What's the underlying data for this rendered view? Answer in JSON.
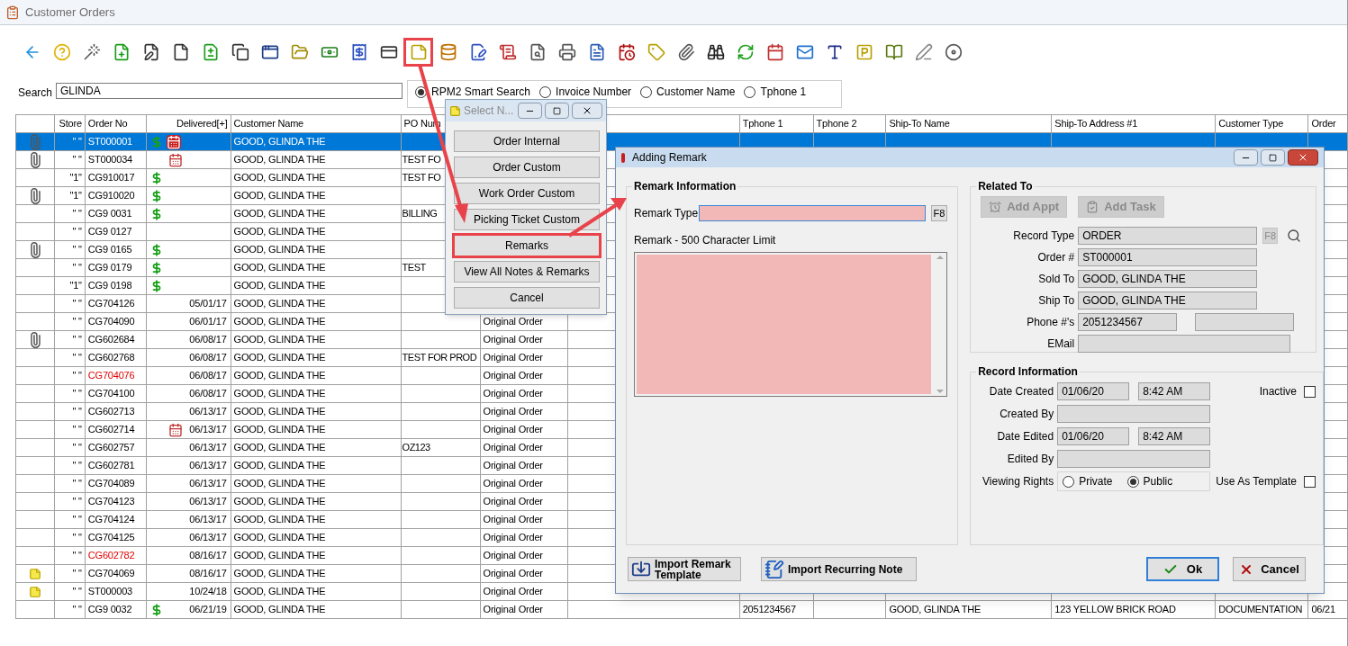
{
  "window": {
    "title": "Customer Orders"
  },
  "toolbar": [
    {
      "kind": "back",
      "highlighted": false
    },
    {
      "kind": "help",
      "highlighted": false
    },
    {
      "kind": "wand",
      "highlighted": false
    },
    {
      "kind": "add",
      "highlighted": false
    },
    {
      "kind": "edit",
      "highlighted": false
    },
    {
      "kind": "file",
      "highlighted": false
    },
    {
      "kind": "diff",
      "highlighted": false
    },
    {
      "kind": "copy",
      "highlighted": false
    },
    {
      "kind": "windows",
      "highlighted": false
    },
    {
      "kind": "folder",
      "highlighted": false
    },
    {
      "kind": "money",
      "highlighted": false
    },
    {
      "kind": "receipt",
      "highlighted": false
    },
    {
      "kind": "credit",
      "highlighted": false
    },
    {
      "kind": "note",
      "highlighted": true
    },
    {
      "kind": "database",
      "highlighted": false
    },
    {
      "kind": "sign",
      "highlighted": false
    },
    {
      "kind": "check",
      "highlighted": false
    },
    {
      "kind": "preview",
      "highlighted": false
    },
    {
      "kind": "print",
      "highlighted": false
    },
    {
      "kind": "document",
      "highlighted": false
    },
    {
      "kind": "due",
      "highlighted": false
    },
    {
      "kind": "ticket",
      "highlighted": false
    },
    {
      "kind": "attach",
      "highlighted": false
    },
    {
      "kind": "find",
      "highlighted": false
    },
    {
      "kind": "refresh",
      "highlighted": false
    },
    {
      "kind": "calendar",
      "highlighted": false
    },
    {
      "kind": "mail",
      "highlighted": false
    },
    {
      "kind": "type",
      "highlighted": false
    },
    {
      "kind": "parking",
      "highlighted": false
    },
    {
      "kind": "book",
      "highlighted": false
    },
    {
      "kind": "pen",
      "highlighted": false
    },
    {
      "kind": "disc",
      "highlighted": false
    }
  ],
  "search": {
    "label": "Search",
    "value": "GLINDA",
    "modes": [
      {
        "label": "RPM2 Smart Search",
        "selected": true
      },
      {
        "label": "Invoice Number",
        "selected": false
      },
      {
        "label": "Customer Name",
        "selected": false
      },
      {
        "label": "Tphone 1",
        "selected": false
      }
    ]
  },
  "table": {
    "columns": {
      "store": "Store",
      "order_no": "Order No",
      "delivered": "Delivered[+]",
      "customer_name": "Customer Name",
      "po_number": "PO Num",
      "tphone_1": "Tphone 1",
      "tphone_2": "Tphone 2",
      "ship_to_name": "Ship-To Name",
      "ship_to_address": "Ship-To Address #1",
      "customer_type": "Customer Type",
      "order": "Order"
    },
    "rows": [
      {
        "attachment": true,
        "note": false,
        "paid": true,
        "alert": true,
        "scheduled": false,
        "store": "\" \"",
        "order_no": "ST000001",
        "customer_name": "GOOD, GLINDA THE",
        "flagged": false,
        "selected": true
      },
      {
        "attachment": true,
        "note": false,
        "paid": false,
        "alert": false,
        "scheduled": true,
        "store": "\" \"",
        "order_no": "ST000034",
        "customer_name": "GOOD, GLINDA THE",
        "po_number": "TEST FO",
        "flagged": false,
        "selected": false
      },
      {
        "attachment": false,
        "note": false,
        "paid": true,
        "alert": false,
        "scheduled": false,
        "store": "\"1\"",
        "order_no": "CG910017",
        "customer_name": "GOOD, GLINDA THE",
        "po_number": "TEST FO",
        "flagged": false,
        "selected": false
      },
      {
        "attachment": true,
        "note": false,
        "paid": true,
        "alert": false,
        "scheduled": false,
        "store": "\"1\"",
        "order_no": "CG910020",
        "customer_name": "GOOD, GLINDA THE",
        "flagged": false,
        "selected": false
      },
      {
        "attachment": false,
        "note": false,
        "paid": true,
        "alert": false,
        "scheduled": false,
        "store": "\" \"",
        "order_no": "CG9 0031",
        "customer_name": "GOOD, GLINDA THE",
        "po_number": "BILLING",
        "flagged": false,
        "selected": false
      },
      {
        "attachment": false,
        "note": false,
        "paid": false,
        "alert": false,
        "scheduled": false,
        "store": "\" \"",
        "order_no": "CG9 0127",
        "customer_name": "GOOD, GLINDA THE",
        "flagged": false,
        "selected": false
      },
      {
        "attachment": true,
        "note": false,
        "paid": true,
        "alert": false,
        "scheduled": false,
        "store": "\" \"",
        "order_no": "CG9 0165",
        "customer_name": "GOOD, GLINDA THE",
        "flagged": false,
        "selected": false
      },
      {
        "attachment": false,
        "note": false,
        "paid": true,
        "alert": false,
        "scheduled": false,
        "store": "\" \"",
        "order_no": "CG9 0179",
        "customer_name": "GOOD, GLINDA THE",
        "po_number": "TEST",
        "flagged": false,
        "selected": false
      },
      {
        "attachment": false,
        "note": false,
        "paid": true,
        "alert": false,
        "scheduled": false,
        "store": "\"1\"",
        "order_no": "CG9 0198",
        "customer_name": "GOOD, GLINDA THE",
        "flagged": false,
        "selected": false
      },
      {
        "attachment": false,
        "note": false,
        "paid": false,
        "alert": false,
        "scheduled": false,
        "store": "\" \"",
        "order_no": "CG704126",
        "delivered": "05/01/17",
        "customer_name": "GOOD, GLINDA THE",
        "flagged": false,
        "selected": false
      },
      {
        "attachment": false,
        "note": false,
        "paid": false,
        "alert": false,
        "scheduled": false,
        "store": "\" \"",
        "order_no": "CG704090",
        "delivered": "06/01/17",
        "customer_name": "GOOD, GLINDA THE",
        "column_7": "Original Order",
        "flagged": false,
        "selected": false
      },
      {
        "attachment": true,
        "note": false,
        "paid": false,
        "alert": false,
        "scheduled": false,
        "store": "\" \"",
        "order_no": "CG602684",
        "delivered": "06/08/17",
        "customer_name": "GOOD, GLINDA THE",
        "column_7": "Original Order",
        "flagged": false,
        "selected": false
      },
      {
        "attachment": false,
        "note": false,
        "paid": false,
        "alert": false,
        "scheduled": false,
        "store": "\" \"",
        "order_no": "CG602768",
        "delivered": "06/08/17",
        "customer_name": "GOOD, GLINDA THE",
        "po_number": "TEST FOR PROD",
        "column_7": "Original Order",
        "flagged": false,
        "selected": false
      },
      {
        "attachment": false,
        "note": false,
        "paid": false,
        "alert": false,
        "scheduled": false,
        "store": "\" \"",
        "order_no": "CG704076",
        "delivered": "06/08/17",
        "customer_name": "GOOD, GLINDA THE",
        "column_7": "Original Order",
        "flagged": true,
        "selected": false
      },
      {
        "attachment": false,
        "note": false,
        "paid": false,
        "alert": false,
        "scheduled": false,
        "store": "\" \"",
        "order_no": "CG704100",
        "delivered": "06/08/17",
        "customer_name": "GOOD, GLINDA THE",
        "column_7": "Original Order",
        "flagged": false,
        "selected": false
      },
      {
        "attachment": false,
        "note": false,
        "paid": false,
        "alert": false,
        "scheduled": false,
        "store": "\" \"",
        "order_no": "CG602713",
        "delivered": "06/13/17",
        "customer_name": "GOOD, GLINDA THE",
        "column_7": "Original Order",
        "flagged": false,
        "selected": false
      },
      {
        "attachment": false,
        "note": false,
        "paid": false,
        "alert": false,
        "scheduled": true,
        "store": "\" \"",
        "order_no": "CG602714",
        "delivered": "06/13/17",
        "customer_name": "GOOD, GLINDA THE",
        "column_7": "Original Order",
        "flagged": false,
        "selected": false
      },
      {
        "attachment": false,
        "note": false,
        "paid": false,
        "alert": false,
        "scheduled": false,
        "store": "\" \"",
        "order_no": "CG602757",
        "delivered": "06/13/17",
        "customer_name": "GOOD, GLINDA THE",
        "po_number": "OZ123",
        "column_7": "Original Order",
        "flagged": false,
        "selected": false
      },
      {
        "attachment": false,
        "note": false,
        "paid": false,
        "alert": false,
        "scheduled": false,
        "store": "\" \"",
        "order_no": "CG602781",
        "delivered": "06/13/17",
        "customer_name": "GOOD, GLINDA THE",
        "column_7": "Original Order",
        "flagged": false,
        "selected": false
      },
      {
        "attachment": false,
        "note": false,
        "paid": false,
        "alert": false,
        "scheduled": false,
        "store": "\" \"",
        "order_no": "CG704089",
        "delivered": "06/13/17",
        "customer_name": "GOOD, GLINDA THE",
        "column_7": "Original Order",
        "flagged": false,
        "selected": false
      },
      {
        "attachment": false,
        "note": false,
        "paid": false,
        "alert": false,
        "scheduled": false,
        "store": "\" \"",
        "order_no": "CG704123",
        "delivered": "06/13/17",
        "customer_name": "GOOD, GLINDA THE",
        "column_7": "Original Order",
        "flagged": false,
        "selected": false
      },
      {
        "attachment": false,
        "note": false,
        "paid": false,
        "alert": false,
        "scheduled": false,
        "store": "\" \"",
        "order_no": "CG704124",
        "delivered": "06/13/17",
        "customer_name": "GOOD, GLINDA THE",
        "column_7": "Original Order",
        "flagged": false,
        "selected": false
      },
      {
        "attachment": false,
        "note": false,
        "paid": false,
        "alert": false,
        "scheduled": false,
        "store": "\" \"",
        "order_no": "CG704125",
        "delivered": "06/13/17",
        "customer_name": "GOOD, GLINDA THE",
        "column_7": "Original Order",
        "flagged": false,
        "selected": false
      },
      {
        "attachment": false,
        "note": false,
        "paid": false,
        "alert": false,
        "scheduled": false,
        "store": "\" \"",
        "order_no": "CG602782",
        "delivered": "08/16/17",
        "customer_name": "GOOD, GLINDA THE",
        "column_7": "Original Order",
        "flagged": true,
        "selected": false
      },
      {
        "attachment": false,
        "note": true,
        "paid": false,
        "alert": false,
        "scheduled": false,
        "store": "\" \"",
        "order_no": "CG704069",
        "delivered": "08/16/17",
        "customer_name": "GOOD, GLINDA THE",
        "column_7": "Original Order",
        "flagged": false,
        "selected": false
      },
      {
        "attachment": false,
        "note": true,
        "paid": false,
        "alert": false,
        "scheduled": false,
        "store": "\" \"",
        "order_no": "ST000003",
        "delivered": "10/24/18",
        "customer_name": "GOOD, GLINDA THE",
        "column_7": "Original Order",
        "flagged": false,
        "selected": false
      },
      {
        "attachment": false,
        "note": false,
        "paid": true,
        "alert": false,
        "scheduled": false,
        "store": "\" \"",
        "order_no": "CG9 0032",
        "delivered": "06/21/19",
        "customer_name": "GOOD, GLINDA THE",
        "column_7": "Original Order",
        "tphone_1": "2051234567",
        "ship_to_name": "GOOD, GLINDA THE",
        "ship_to_address": "123 YELLOW BRICK ROAD",
        "customer_type": "DOCUMENTATION",
        "order": "06/21",
        "flagged": false,
        "selected": false
      }
    ]
  },
  "menu": {
    "title": "Select N...",
    "items": [
      {
        "label": "Order Internal",
        "highlighted": false
      },
      {
        "label": "Order Custom",
        "highlighted": false
      },
      {
        "label": "Work Order Custom",
        "highlighted": false
      },
      {
        "label": "Picking Ticket Custom",
        "highlighted": false
      },
      {
        "label": "Remarks",
        "highlighted": true
      },
      {
        "label": "View All Notes & Remarks",
        "highlighted": false
      },
      {
        "label": "Cancel",
        "highlighted": false
      }
    ]
  },
  "dialog": {
    "title": "Adding Remark",
    "remark_information": {
      "title": "Remark Information",
      "type_label": "Remark Type",
      "type_key": "F8",
      "text_label": "Remark - 500 Character Limit",
      "required": true
    },
    "related_to": {
      "title": "Related To",
      "buttons": [
        {
          "label": "Add Appt",
          "kind": "appointment",
          "disabled": true
        },
        {
          "label": "Add Task",
          "kind": "task",
          "disabled": true
        }
      ],
      "fields": [
        {
          "kind": "lookup",
          "label": "Record Type",
          "values": [
            "ORDER"
          ],
          "key": "F8"
        },
        {
          "kind": "text",
          "label": "Order #",
          "values": [
            "ST000001"
          ]
        },
        {
          "kind": "text",
          "label": "Sold To",
          "values": [
            "GOOD, GLINDA THE"
          ]
        },
        {
          "kind": "text",
          "label": "Ship To",
          "values": [
            "GOOD, GLINDA THE"
          ]
        },
        {
          "kind": "pair",
          "label": "Phone #'s",
          "values": [
            "2051234567"
          ]
        },
        {
          "kind": "long",
          "label": "EMail"
        }
      ]
    },
    "record_information": {
      "title": "Record Information",
      "rows": [
        {
          "kind": "datetime",
          "label": "Date Created",
          "values": [
            "01/06/20",
            "8:42 AM"
          ],
          "checkbox": {
            "label": "Inactive",
            "checked": false
          }
        },
        {
          "kind": "text",
          "label": "Created By"
        },
        {
          "kind": "datetime",
          "label": "Date Edited",
          "values": [
            "01/06/20",
            "8:42 AM"
          ]
        },
        {
          "kind": "text",
          "label": "Edited By"
        },
        {
          "kind": "radio",
          "label": "Viewing Rights",
          "options": [
            {
              "label": "Private",
              "selected": false
            },
            {
              "label": "Public",
              "selected": true
            }
          ],
          "checkbox": {
            "label": "Use As Template",
            "checked": false
          }
        }
      ]
    },
    "buttons": [
      {
        "kind": "import-template",
        "label": "Import Remark Template"
      },
      {
        "kind": "import-note",
        "label": "Import Recurring Note"
      },
      {
        "kind": "ok",
        "label": "Ok"
      },
      {
        "kind": "cancel",
        "label": "Cancel"
      }
    ]
  }
}
